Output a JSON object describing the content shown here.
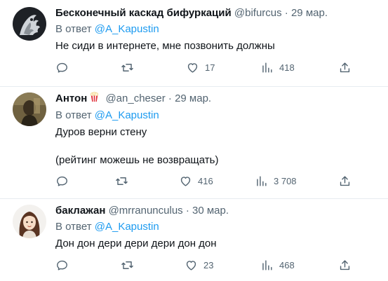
{
  "reply_prefix": "В ответ",
  "tweets": [
    {
      "name": "Бесконечный каскад бифуркаций",
      "handle": "@bifurcus",
      "date": "29 мар.",
      "reply_to": "@A_Kapustin",
      "text": "Не сиди в интернете, мне позвонить должны",
      "replies": "",
      "retweets": "",
      "likes": "17",
      "views": "418"
    },
    {
      "name": "Антон",
      "handle": "@an_cheser",
      "date": "29 мар.",
      "reply_to": "@A_Kapustin",
      "text": "Дуров верни стену\n\n(рейтинг можешь не возвращать)",
      "replies": "",
      "retweets": "",
      "likes": "416",
      "views": "3 708"
    },
    {
      "name": "баклажан",
      "handle": "@mrranunculus",
      "date": "30 мар.",
      "reply_to": "@A_Kapustin",
      "text": "Дон дон дери дери дери дон дон",
      "replies": "",
      "retweets": "",
      "likes": "23",
      "views": "468"
    }
  ],
  "icons": [
    "reply-icon",
    "retweet-icon",
    "like-icon",
    "views-icon",
    "share-icon",
    "popcorn-emoji-icon"
  ],
  "colors": {
    "link": "#1d9bf0",
    "muted": "#536471",
    "text": "#0f1419",
    "divider": "#e6ecf0"
  }
}
